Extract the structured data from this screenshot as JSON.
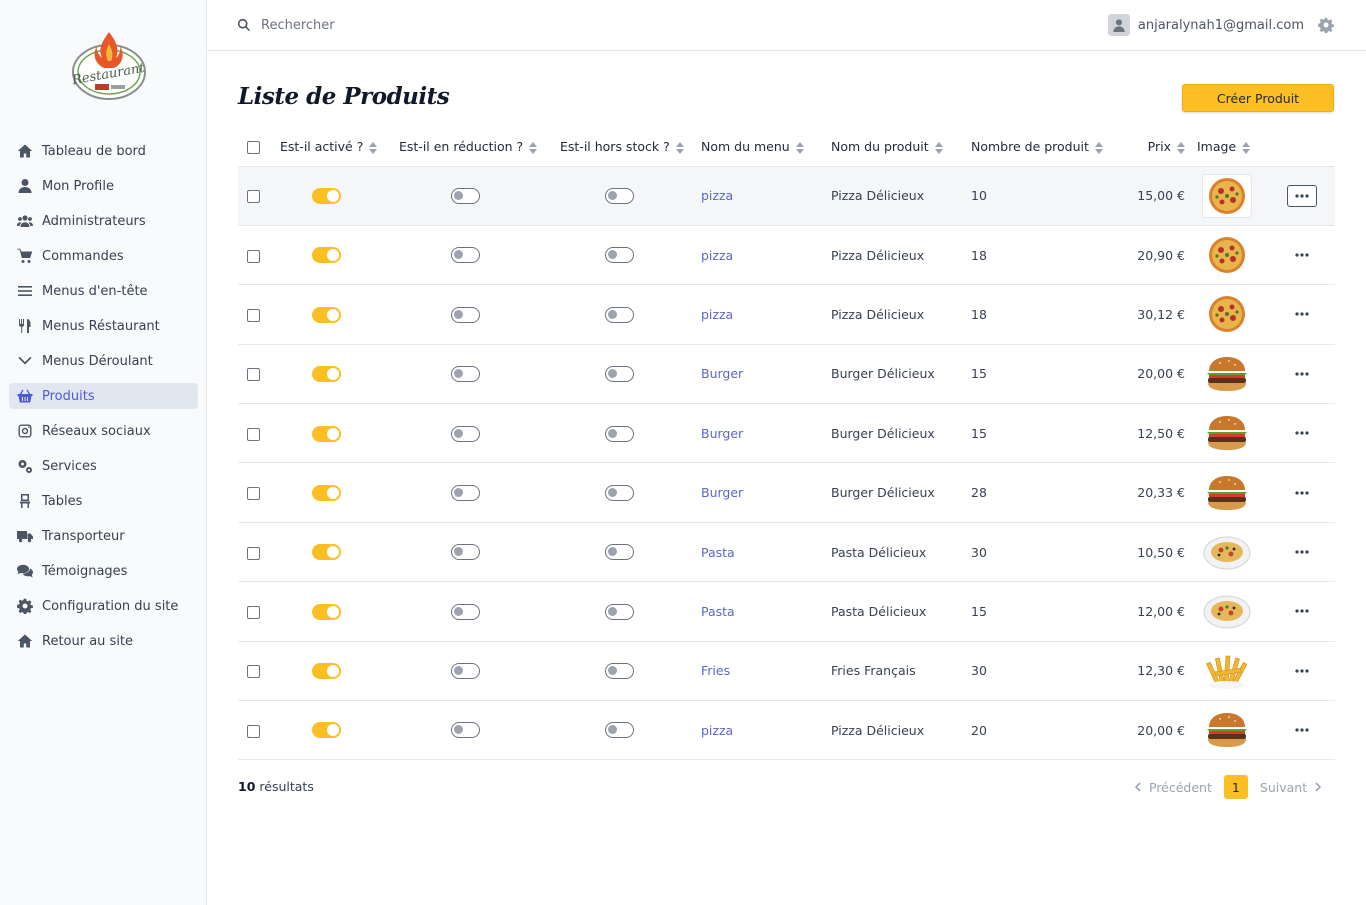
{
  "sidebar": {
    "items": [
      {
        "label": "Tableau de bord",
        "icon": "home-icon"
      },
      {
        "label": "Mon Profile",
        "icon": "user-icon"
      },
      {
        "label": "Administrateurs",
        "icon": "users-icon"
      },
      {
        "label": "Commandes",
        "icon": "cart-icon"
      },
      {
        "label": "Menus d'en-tête",
        "icon": "bars-icon"
      },
      {
        "label": "Menus Réstaurant",
        "icon": "utensils-icon"
      },
      {
        "label": "Menus Déroulant",
        "icon": "chevron-down-icon"
      },
      {
        "label": "Produits",
        "icon": "basket-icon",
        "active": true
      },
      {
        "label": "Réseaux sociaux",
        "icon": "instagram-icon"
      },
      {
        "label": "Services",
        "icon": "cogs-icon"
      },
      {
        "label": "Tables",
        "icon": "chair-icon"
      },
      {
        "label": "Transporteur",
        "icon": "truck-icon"
      },
      {
        "label": "Témoignages",
        "icon": "comments-icon"
      },
      {
        "label": "Configuration du site",
        "icon": "gear-icon"
      },
      {
        "label": "Retour au site",
        "icon": "home-icon"
      }
    ]
  },
  "topbar": {
    "search_placeholder": "Rechercher",
    "user_email": "anjaralynah1@gmail.com"
  },
  "page": {
    "title": "Liste de Produits",
    "create_button": "Créer Produit"
  },
  "table": {
    "headers": [
      "Est-il activé ?",
      "Est-il en réduction ?",
      "Est-il hors stock ?",
      "Nom du menu",
      "Nom du produit",
      "Nombre de produit",
      "Prix",
      "Image"
    ],
    "rows": [
      {
        "active": true,
        "discount": false,
        "out_of_stock": false,
        "menu": "pizza",
        "product": "Pizza Délicieux",
        "quantity": "10",
        "price": "15,00 €",
        "image": "pizza"
      },
      {
        "active": true,
        "discount": false,
        "out_of_stock": false,
        "menu": "pizza",
        "product": "Pizza Délicieux",
        "quantity": "18",
        "price": "20,90 €",
        "image": "pizza"
      },
      {
        "active": true,
        "discount": false,
        "out_of_stock": false,
        "menu": "pizza",
        "product": "Pizza Délicieux",
        "quantity": "18",
        "price": "30,12 €",
        "image": "pizza"
      },
      {
        "active": true,
        "discount": false,
        "out_of_stock": false,
        "menu": "Burger",
        "product": "Burger Délicieux",
        "quantity": "15",
        "price": "20,00 €",
        "image": "burger"
      },
      {
        "active": true,
        "discount": false,
        "out_of_stock": false,
        "menu": "Burger",
        "product": "Burger Délicieux",
        "quantity": "15",
        "price": "12,50 €",
        "image": "burger"
      },
      {
        "active": true,
        "discount": false,
        "out_of_stock": false,
        "menu": "Burger",
        "product": "Burger Délicieux",
        "quantity": "28",
        "price": "20,33 €",
        "image": "burger"
      },
      {
        "active": true,
        "discount": false,
        "out_of_stock": false,
        "menu": "Pasta",
        "product": "Pasta Délicieux",
        "quantity": "30",
        "price": "10,50 €",
        "image": "pasta"
      },
      {
        "active": true,
        "discount": false,
        "out_of_stock": false,
        "menu": "Pasta",
        "product": "Pasta Délicieux",
        "quantity": "15",
        "price": "12,00 €",
        "image": "pasta"
      },
      {
        "active": true,
        "discount": false,
        "out_of_stock": false,
        "menu": "Fries",
        "product": "Fries Français",
        "quantity": "30",
        "price": "12,30 €",
        "image": "fries"
      },
      {
        "active": true,
        "discount": false,
        "out_of_stock": false,
        "menu": "pizza",
        "product": "Pizza Délicieux",
        "quantity": "20",
        "price": "20,00 €",
        "image": "burger"
      }
    ]
  },
  "footer": {
    "results_count": "10",
    "results_label": "résultats",
    "prev_label": "Précédent",
    "current_page": "1",
    "next_label": "Suivant"
  },
  "colors": {
    "accent": "#fbbf24",
    "link": "#5b67c9",
    "active_nav_bg": "#e1e6ef"
  }
}
